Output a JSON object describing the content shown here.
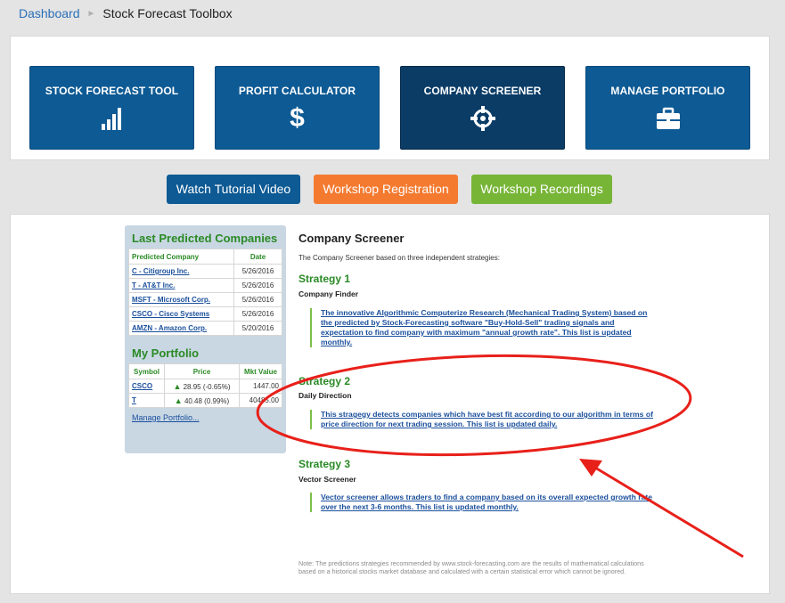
{
  "breadcrumb": {
    "home": "Dashboard",
    "separator": "►",
    "current": "Stock Forecast Toolbox"
  },
  "tools": [
    {
      "label": "STOCK FORECAST TOOL",
      "icon": "bar-chart-icon"
    },
    {
      "label": "PROFIT CALCULATOR",
      "icon": "dollar-icon",
      "glyph": "$"
    },
    {
      "label": "COMPANY SCREENER",
      "icon": "crosshair-icon",
      "active": true
    },
    {
      "label": "MANAGE PORTFOLIO",
      "icon": "briefcase-icon"
    }
  ],
  "actions": {
    "tutorial": "Watch Tutorial Video",
    "registration": "Workshop Registration",
    "recordings": "Workshop Recordings"
  },
  "colors": {
    "primary": "#0d5a94",
    "active": "#0a3c66",
    "orange": "#f47a30",
    "green": "#77b537",
    "heading_green": "#2a8a25",
    "annotation_red": "#e8201a"
  },
  "sidebar": {
    "predicted": {
      "title": "Last Predicted Companies",
      "columns": [
        "Predicted Company",
        "Date"
      ],
      "rows": [
        {
          "company": "C - Citigroup Inc.",
          "date": "5/26/2016"
        },
        {
          "company": "T - AT&T Inc.",
          "date": "5/26/2016"
        },
        {
          "company": "MSFT - Microsoft Corp.",
          "date": "5/26/2016"
        },
        {
          "company": "CSCO - Cisco Systems",
          "date": "5/26/2016"
        },
        {
          "company": "AMZN - Amazon Corp.",
          "date": "5/20/2016"
        }
      ]
    },
    "portfolio": {
      "title": "My Portfolio",
      "columns": [
        "Symbol",
        "Price",
        "Mkt Value"
      ],
      "rows": [
        {
          "symbol": "CSCO",
          "price": "28.95 (-0.65%)",
          "value": "1447.00"
        },
        {
          "symbol": "T",
          "price": "40.48 (0.99%)",
          "value": "40485.00"
        }
      ],
      "manage_link": "Manage Portfolio..."
    }
  },
  "content": {
    "title": "Company Screener",
    "intro": "The Company Screener based on three independent strategies:",
    "strategies": [
      {
        "title": "Strategy 1",
        "subtitle": "Company Finder",
        "description": "The innovative Algorithmic Computerize Research (Mechanical Trading System) based on the predicted by Stock-Forecasting software \"Buy-Hold-Sell\" trading signals and expectation to find company with maximum \"annual growth rate\". This list is updated monthly."
      },
      {
        "title": "Strategy 2",
        "subtitle": "Daily Direction",
        "description": "This stragegy detects companies which have best fit according to our algorithm in terms of price direction for next trading session. This list is updated daily."
      },
      {
        "title": "Strategy 3",
        "subtitle": "Vector Screener",
        "description": "Vector screener allows traders to find a company based on its overall expected growth rate over the next 3-6 months. This list is updated monthly."
      }
    ],
    "note": "Note: The predictions strategies recommended by www.stock-forecasting.com are the results of mathematical calculations based on a historical stocks market database and calculated with a certain statistical error which cannot be ignored."
  }
}
